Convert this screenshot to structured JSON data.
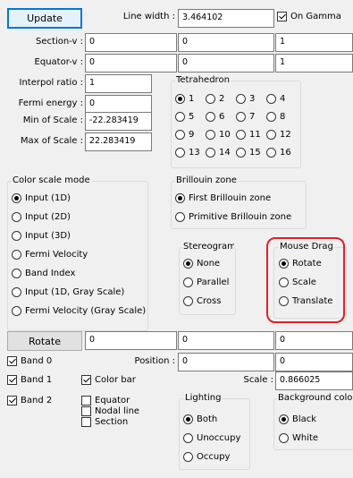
{
  "top": {
    "update_label": "Update",
    "line_width_label": "Line width :",
    "line_width_value": "3.464102",
    "on_gamma_label": "On Gamma",
    "section_v_label": "Section-v :",
    "section_v": [
      "0",
      "0",
      "1"
    ],
    "equator_v_label": "Equator-v :",
    "equator_v": [
      "0",
      "0",
      "1"
    ],
    "interpol_label": "Interpol ratio :",
    "interpol_value": "1",
    "fermi_label": "Fermi energy :",
    "fermi_value": "0",
    "min_scale_label": "Min of Scale :",
    "min_scale_value": "-22.283419",
    "max_scale_label": "Max of Scale :",
    "max_scale_value": "22.283419"
  },
  "tetrahedron": {
    "title": "Tetrahedron",
    "options": [
      "1",
      "2",
      "3",
      "4",
      "5",
      "6",
      "7",
      "8",
      "9",
      "10",
      "11",
      "12",
      "13",
      "14",
      "15",
      "16"
    ],
    "selected": "1"
  },
  "color_scale": {
    "title": "Color scale mode",
    "options": [
      "Input (1D)",
      "Input (2D)",
      "Input (3D)",
      "Fermi Velocity",
      "Band Index",
      "Input (1D, Gray Scale)",
      "Fermi Velocity (Gray Scale)"
    ],
    "selected": "Input (1D)"
  },
  "brillouin": {
    "title": "Brillouin zone",
    "options": [
      "First Brillouin zone",
      "Primitive Brillouin zone"
    ],
    "selected": "First Brillouin zone"
  },
  "stereogram": {
    "title": "Stereogram",
    "options": [
      "None",
      "Parallel",
      "Cross"
    ],
    "selected": "None"
  },
  "mouse_drag": {
    "title": "Mouse Drag",
    "options": [
      "Rotate",
      "Scale",
      "Translate"
    ],
    "selected": "Rotate"
  },
  "rotate_row": {
    "button_label": "Rotate",
    "values": [
      "0",
      "0",
      "0"
    ]
  },
  "bands": {
    "band0_label": "Band 0",
    "band1_label": "Band 1",
    "band2_label": "Band 2",
    "position_label": "Position :",
    "position_values": [
      "0",
      "0"
    ],
    "color_bar_label": "Color bar",
    "scale_label": "Scale :",
    "scale_value": "0.866025",
    "equator_label": "Equator",
    "nodal_line_label": "Nodal line",
    "section_label": "Section"
  },
  "lighting": {
    "title": "Lighting",
    "options": [
      "Both",
      "Unoccupy",
      "Occupy"
    ],
    "selected": "Both"
  },
  "background": {
    "title": "Background color",
    "options": [
      "Black",
      "White"
    ],
    "selected": "Black"
  }
}
